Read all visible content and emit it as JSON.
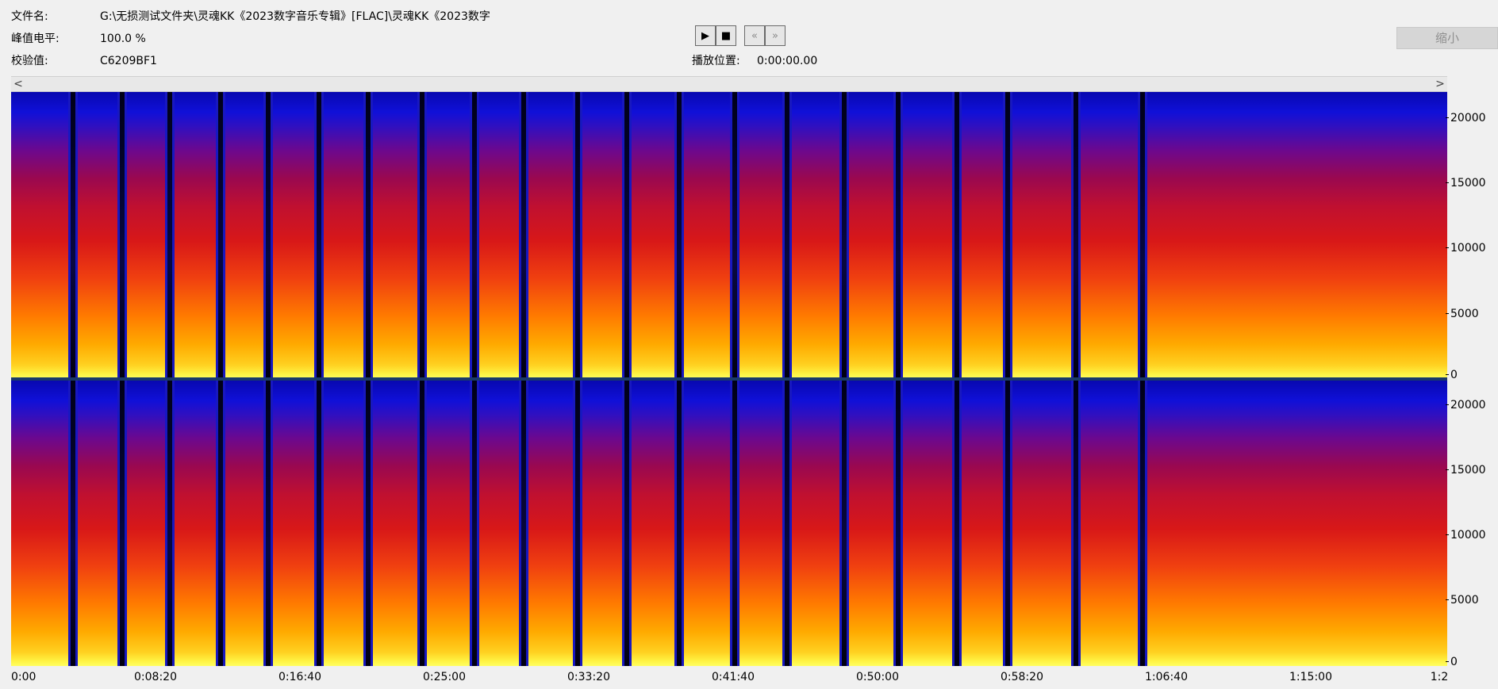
{
  "info": {
    "filename_label": "文件名:",
    "filename_value": "G:\\无损测试文件夹\\灵魂KK《2023数字音乐专辑》[FLAC]\\灵魂KK《2023数字",
    "peak_label": "峰值电平:",
    "peak_value": "100.0 %",
    "checksum_label": "校验值:",
    "checksum_value": "C6209BF1"
  },
  "transport": {
    "play_glyph": "▶",
    "stop_glyph": "■",
    "rewind_glyph": "«",
    "forward_glyph": "»"
  },
  "playback": {
    "position_label": "播放位置:",
    "position_value": "0:00:00.00"
  },
  "shrink_button": {
    "label": "缩小"
  },
  "scrollbar": {
    "left_arrow": "<",
    "right_arrow": ">"
  },
  "spectrogram": {
    "channels": [
      {
        "freq_ticks": [
          "20000",
          "15000",
          "10000",
          "5000",
          "0"
        ]
      },
      {
        "freq_ticks": [
          "20000",
          "15000",
          "10000",
          "5000",
          "0"
        ]
      }
    ],
    "time_ticks": [
      "0:00",
      "0:08:20",
      "0:16:40",
      "0:25:00",
      "0:33:20",
      "0:41:40",
      "0:50:00",
      "0:58:20",
      "1:06:40",
      "1:15:00",
      "1:2"
    ]
  }
}
